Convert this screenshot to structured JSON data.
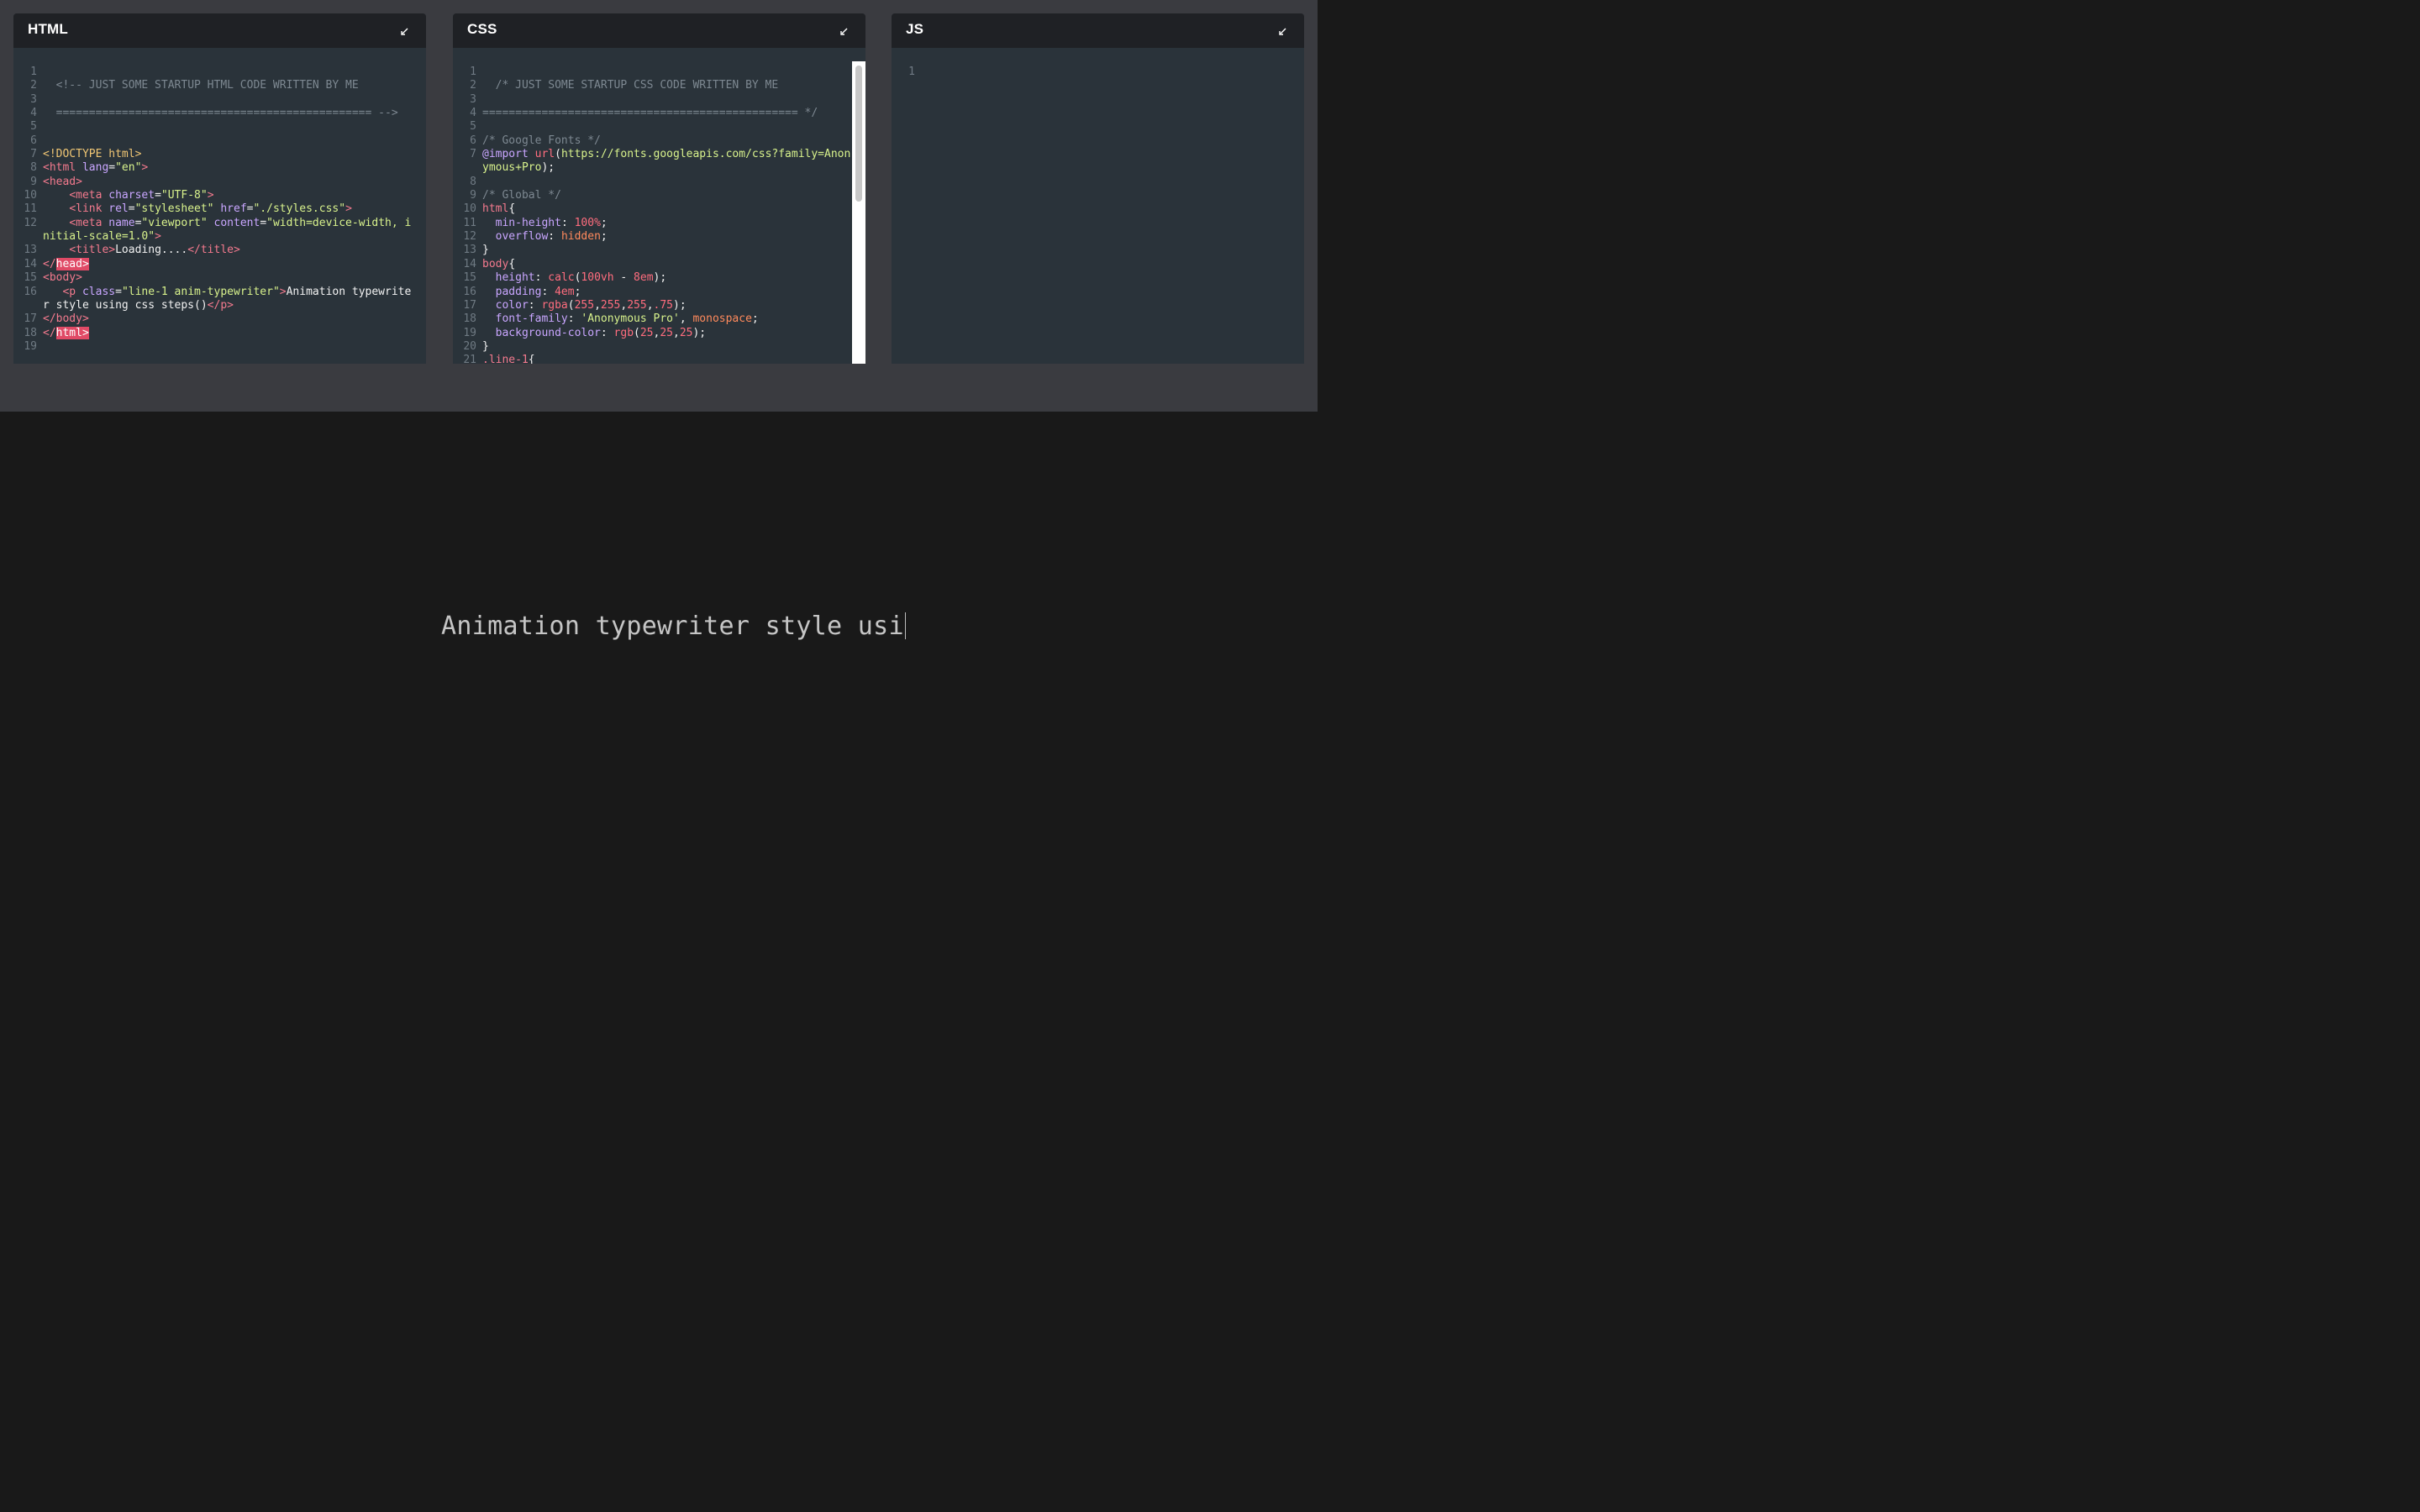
{
  "panels": [
    {
      "title": "HTML",
      "lines": [
        {
          "n": "1",
          "segs": []
        },
        {
          "n": "2",
          "segs": [
            {
              "t": "  <!-- JUST SOME STARTUP HTML CODE WRITTEN BY ME",
              "c": "c-comment"
            }
          ]
        },
        {
          "n": "3",
          "segs": []
        },
        {
          "n": "4",
          "segs": [
            {
              "t": "  ================================================ -->",
              "c": "c-comment"
            }
          ]
        },
        {
          "n": "5",
          "segs": []
        },
        {
          "n": "6",
          "segs": []
        },
        {
          "n": "7",
          "segs": [
            {
              "t": "<!DOCTYPE html>",
              "c": "c-doctype"
            }
          ]
        },
        {
          "n": "8",
          "segs": [
            {
              "t": "<html ",
              "c": "c-tag"
            },
            {
              "t": "lang",
              "c": "c-attr"
            },
            {
              "t": "=",
              "c": "c-text"
            },
            {
              "t": "\"en\"",
              "c": "c-str"
            },
            {
              "t": ">",
              "c": "c-tag"
            }
          ]
        },
        {
          "n": "9",
          "segs": [
            {
              "t": "<head>",
              "c": "c-tag"
            }
          ]
        },
        {
          "n": "10",
          "segs": [
            {
              "t": "    <meta ",
              "c": "c-tag"
            },
            {
              "t": "charset",
              "c": "c-attr"
            },
            {
              "t": "=",
              "c": "c-text"
            },
            {
              "t": "\"UTF-8\"",
              "c": "c-str"
            },
            {
              "t": ">",
              "c": "c-tag"
            }
          ]
        },
        {
          "n": "11",
          "segs": [
            {
              "t": "    <link ",
              "c": "c-tag"
            },
            {
              "t": "rel",
              "c": "c-attr"
            },
            {
              "t": "=",
              "c": "c-text"
            },
            {
              "t": "\"stylesheet\" ",
              "c": "c-str"
            },
            {
              "t": "href",
              "c": "c-attr"
            },
            {
              "t": "=",
              "c": "c-text"
            },
            {
              "t": "\"./styles.css\"",
              "c": "c-str"
            },
            {
              "t": ">",
              "c": "c-tag"
            }
          ]
        },
        {
          "n": "12",
          "segs": [
            {
              "t": "    <meta ",
              "c": "c-tag"
            },
            {
              "t": "name",
              "c": "c-attr"
            },
            {
              "t": "=",
              "c": "c-text"
            },
            {
              "t": "\"viewport\" ",
              "c": "c-str"
            },
            {
              "t": "content",
              "c": "c-attr"
            },
            {
              "t": "=",
              "c": "c-text"
            },
            {
              "t": "\"width=device-width, initial-scale=1.0\"",
              "c": "c-str"
            },
            {
              "t": ">",
              "c": "c-tag"
            }
          ]
        },
        {
          "n": "13",
          "segs": [
            {
              "t": "    <title>",
              "c": "c-tag"
            },
            {
              "t": "Loading....",
              "c": "c-text"
            },
            {
              "t": "</title>",
              "c": "c-tag"
            }
          ]
        },
        {
          "n": "14",
          "segs": [
            {
              "t": "</",
              "c": "c-tag"
            },
            {
              "t": "head>",
              "c": "c-hl"
            }
          ]
        },
        {
          "n": "15",
          "segs": [
            {
              "t": "<body>",
              "c": "c-tag"
            }
          ]
        },
        {
          "n": "16",
          "segs": [
            {
              "t": "   <p ",
              "c": "c-tag"
            },
            {
              "t": "class",
              "c": "c-attr"
            },
            {
              "t": "=",
              "c": "c-text"
            },
            {
              "t": "\"line-1 anim-typewriter\"",
              "c": "c-str"
            },
            {
              "t": ">",
              "c": "c-tag"
            },
            {
              "t": "Animation typewriter style using css steps()",
              "c": "c-text"
            },
            {
              "t": "</p>",
              "c": "c-tag"
            }
          ]
        },
        {
          "n": "17",
          "segs": [
            {
              "t": "</body>",
              "c": "c-tag"
            }
          ]
        },
        {
          "n": "18",
          "segs": [
            {
              "t": "</",
              "c": "c-tag"
            },
            {
              "t": "html>",
              "c": "c-hl"
            }
          ]
        },
        {
          "n": "19",
          "segs": []
        }
      ]
    },
    {
      "title": "CSS",
      "lines": [
        {
          "n": "1",
          "segs": []
        },
        {
          "n": "2",
          "segs": [
            {
              "t": "  /* JUST SOME STARTUP CSS CODE WRITTEN BY ME",
              "c": "c-comment"
            }
          ]
        },
        {
          "n": "3",
          "segs": []
        },
        {
          "n": "4",
          "segs": [
            {
              "t": "================================================ */",
              "c": "c-comment"
            }
          ]
        },
        {
          "n": "5",
          "segs": []
        },
        {
          "n": "6",
          "segs": [
            {
              "t": "/* Google Fonts */",
              "c": "c-comment"
            }
          ]
        },
        {
          "n": "7",
          "segs": [
            {
              "t": "@import ",
              "c": "c-kw"
            },
            {
              "t": "url",
              "c": "c-fn"
            },
            {
              "t": "(",
              "c": "c-text"
            },
            {
              "t": "https://fonts.googleapis.com/css?family=Anonymous+Pro",
              "c": "c-str"
            },
            {
              "t": ");",
              "c": "c-text"
            }
          ]
        },
        {
          "n": "8",
          "segs": []
        },
        {
          "n": "9",
          "segs": [
            {
              "t": "/* Global */",
              "c": "c-comment"
            }
          ]
        },
        {
          "n": "10",
          "segs": [
            {
              "t": "html",
              "c": "c-sel"
            },
            {
              "t": "{",
              "c": "c-text"
            }
          ]
        },
        {
          "n": "11",
          "segs": [
            {
              "t": "  min-height",
              "c": "c-prop"
            },
            {
              "t": ": ",
              "c": "c-text"
            },
            {
              "t": "100%",
              "c": "c-num"
            },
            {
              "t": ";",
              "c": "c-text"
            }
          ]
        },
        {
          "n": "12",
          "segs": [
            {
              "t": "  overflow",
              "c": "c-prop"
            },
            {
              "t": ": ",
              "c": "c-text"
            },
            {
              "t": "hidden",
              "c": "c-val"
            },
            {
              "t": ";",
              "c": "c-text"
            }
          ]
        },
        {
          "n": "13",
          "segs": [
            {
              "t": "}",
              "c": "c-text"
            }
          ]
        },
        {
          "n": "14",
          "segs": [
            {
              "t": "body",
              "c": "c-sel"
            },
            {
              "t": "{",
              "c": "c-text"
            }
          ]
        },
        {
          "n": "15",
          "segs": [
            {
              "t": "  height",
              "c": "c-prop"
            },
            {
              "t": ": ",
              "c": "c-text"
            },
            {
              "t": "calc",
              "c": "c-fn"
            },
            {
              "t": "(",
              "c": "c-text"
            },
            {
              "t": "100vh",
              "c": "c-num"
            },
            {
              "t": " - ",
              "c": "c-text"
            },
            {
              "t": "8em",
              "c": "c-num"
            },
            {
              "t": ");",
              "c": "c-text"
            }
          ]
        },
        {
          "n": "16",
          "segs": [
            {
              "t": "  padding",
              "c": "c-prop"
            },
            {
              "t": ": ",
              "c": "c-text"
            },
            {
              "t": "4em",
              "c": "c-num"
            },
            {
              "t": ";",
              "c": "c-text"
            }
          ]
        },
        {
          "n": "17",
          "segs": [
            {
              "t": "  color",
              "c": "c-prop"
            },
            {
              "t": ": ",
              "c": "c-text"
            },
            {
              "t": "rgba",
              "c": "c-fn"
            },
            {
              "t": "(",
              "c": "c-text"
            },
            {
              "t": "255",
              "c": "c-num"
            },
            {
              "t": ",",
              "c": "c-text"
            },
            {
              "t": "255",
              "c": "c-num"
            },
            {
              "t": ",",
              "c": "c-text"
            },
            {
              "t": "255",
              "c": "c-num"
            },
            {
              "t": ",",
              "c": "c-text"
            },
            {
              "t": ".75",
              "c": "c-num"
            },
            {
              "t": ");",
              "c": "c-text"
            }
          ]
        },
        {
          "n": "18",
          "segs": [
            {
              "t": "  font-family",
              "c": "c-prop"
            },
            {
              "t": ": ",
              "c": "c-text"
            },
            {
              "t": "'Anonymous Pro'",
              "c": "c-str"
            },
            {
              "t": ", ",
              "c": "c-text"
            },
            {
              "t": "monospace",
              "c": "c-val"
            },
            {
              "t": ";",
              "c": "c-text"
            }
          ]
        },
        {
          "n": "19",
          "segs": [
            {
              "t": "  background-color",
              "c": "c-prop"
            },
            {
              "t": ": ",
              "c": "c-text"
            },
            {
              "t": "rgb",
              "c": "c-fn"
            },
            {
              "t": "(",
              "c": "c-text"
            },
            {
              "t": "25",
              "c": "c-num"
            },
            {
              "t": ",",
              "c": "c-text"
            },
            {
              "t": "25",
              "c": "c-num"
            },
            {
              "t": ",",
              "c": "c-text"
            },
            {
              "t": "25",
              "c": "c-num"
            },
            {
              "t": ");",
              "c": "c-text"
            }
          ]
        },
        {
          "n": "20",
          "segs": [
            {
              "t": "}",
              "c": "c-text"
            }
          ]
        },
        {
          "n": "21",
          "segs": [
            {
              "t": ".line-1",
              "c": "c-sel"
            },
            {
              "t": "{",
              "c": "c-text"
            }
          ]
        }
      ]
    },
    {
      "title": "JS",
      "lines": [
        {
          "n": "1",
          "segs": []
        }
      ]
    }
  ],
  "preview": {
    "text": "Animation typewriter style usi"
  }
}
